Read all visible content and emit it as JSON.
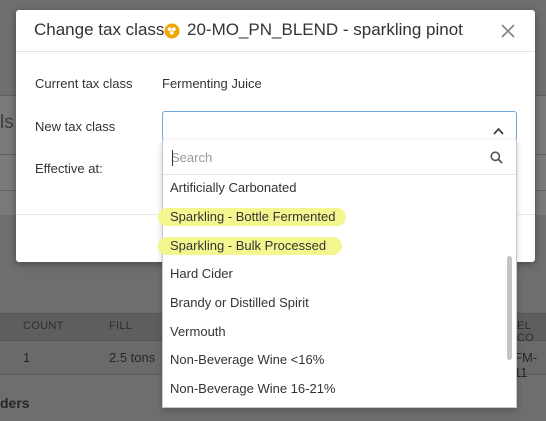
{
  "background": {
    "partial_title": "ls",
    "table_headers": [
      "COUNT",
      "FILL",
      "EL CO"
    ],
    "row_values": [
      "1",
      "2.5 tons",
      "FM-11"
    ],
    "section_label": "ders"
  },
  "modal": {
    "title": "Change tax class",
    "subject": "20-MO_PN_BLEND - sparkling pinot",
    "fields": {
      "current_label": "Current tax class",
      "current_value": "Fermenting Juice",
      "new_label": "New tax class",
      "new_value": "",
      "effective_label": "Effective at:"
    }
  },
  "dropdown": {
    "search_placeholder": "Search",
    "options": [
      "Artificially Carbonated",
      "Sparkling - Bottle Fermented",
      "Sparkling - Bulk Processed",
      "Hard Cider",
      "Brandy or Distilled Spirit",
      "Vermouth",
      "Non-Beverage Wine <16%",
      "Non-Beverage Wine 16-21%"
    ],
    "highlighted_options": [
      "Sparkling - Bottle Fermented",
      "Sparkling - Bulk Processed"
    ]
  },
  "icons": {
    "grape": "grape-icon",
    "close": "close-icon",
    "chevron": "chevron-up-icon",
    "search": "search-icon"
  },
  "colors": {
    "accent_border": "#6fa8dc",
    "highlight": "#f3f78a",
    "icon_orange": "#f0a500",
    "dim_overlay": "#6e6e6e"
  }
}
